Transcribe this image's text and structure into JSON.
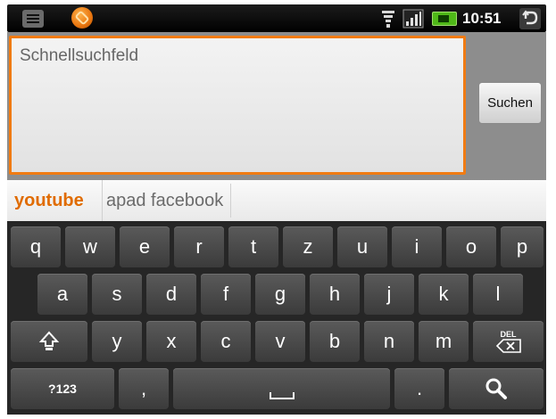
{
  "status_bar": {
    "time": "10:51",
    "icons": [
      "menu-icon",
      "app-icon",
      "wifi-icon",
      "signal-icon",
      "battery-icon",
      "back-icon"
    ]
  },
  "search": {
    "placeholder": "Schnellsuchfeld",
    "value": "",
    "button_label": "Suchen",
    "accent_color": "#f07b13"
  },
  "suggestions": [
    "youtube",
    "apad facebook"
  ],
  "keyboard": {
    "row1": [
      "q",
      "w",
      "e",
      "r",
      "t",
      "z",
      "u",
      "i",
      "o",
      "p"
    ],
    "row2": [
      "a",
      "s",
      "d",
      "f",
      "g",
      "h",
      "j",
      "k",
      "l"
    ],
    "row3": [
      "y",
      "x",
      "c",
      "v",
      "b",
      "n",
      "m"
    ],
    "shift_icon": "shift-icon",
    "delete_label": "DEL",
    "numbers_label": "?123",
    "comma": ",",
    "space_icon": "space-icon",
    "period": ".",
    "search_icon": "search-icon"
  }
}
